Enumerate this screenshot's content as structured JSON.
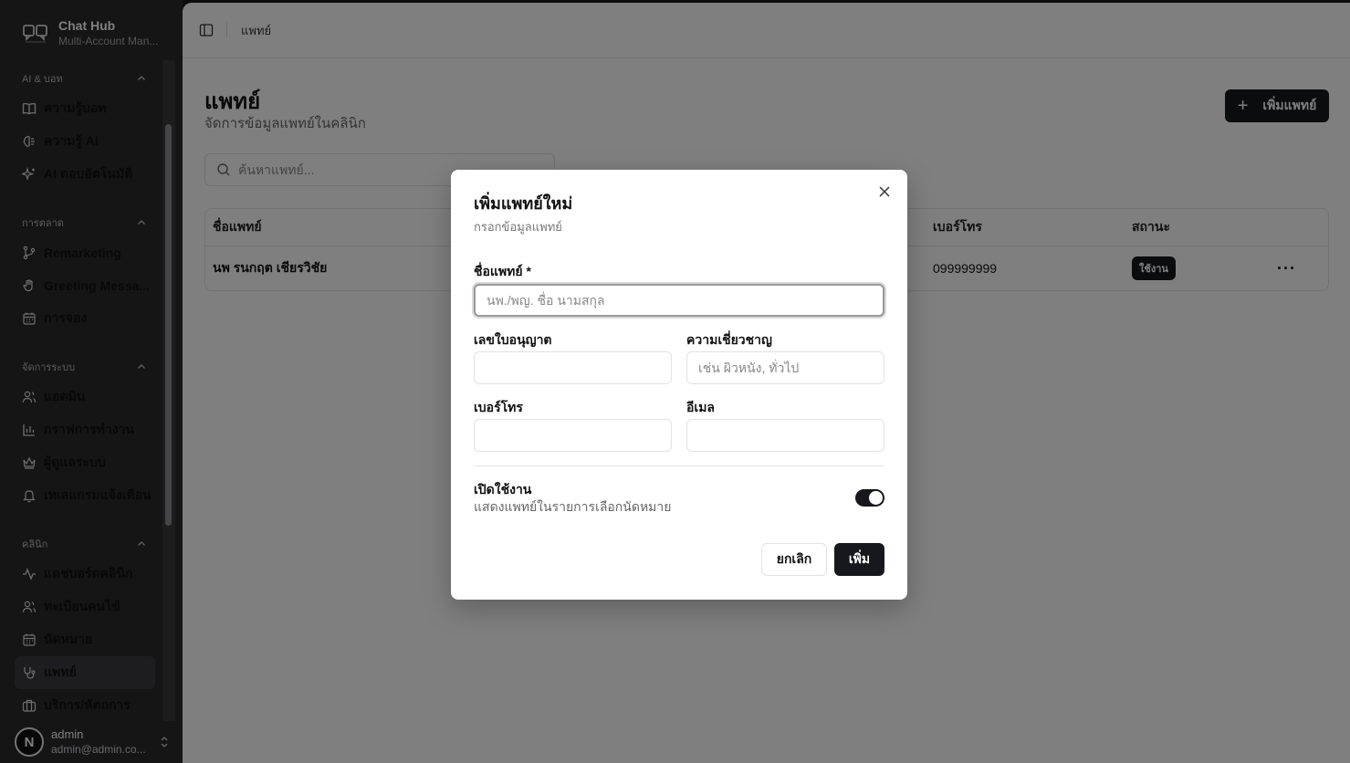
{
  "app": {
    "name": "Chat Hub",
    "subtitle": "Multi-Account Man..."
  },
  "sidebar": {
    "groups": [
      {
        "title": "AI & บอท",
        "items": [
          "ความรู้บอท",
          "ความรู้ AI",
          "AI ตอบอัตโนมัติ"
        ]
      },
      {
        "title": "การตลาด",
        "items": [
          "Remarketing",
          "Greeting Messa...",
          "การจอง"
        ]
      },
      {
        "title": "จัดการระบบ",
        "items": [
          "แอดมิน",
          "กราฟการทำงาน",
          "ผู้ดูแลระบบ",
          "เทเลแกรมแจ้งเตือน"
        ]
      },
      {
        "title": "คลินิก",
        "items": [
          "แดชบอร์ดคลินิก",
          "ทะเบียนคนไข้",
          "นัดหมาย",
          "แพทย์",
          "บริการ/หัตถการ"
        ]
      }
    ],
    "active_item": "แพทย์"
  },
  "user": {
    "avatar_letter": "N",
    "name": "admin",
    "email": "admin@admin.co..."
  },
  "topbar": {
    "breadcrumb": "แพทย์"
  },
  "page": {
    "title": "แพทย์",
    "subtitle": "จัดการข้อมูลแพทย์ในคลินิก",
    "add_button": "เพิ่มแพทย์",
    "search_placeholder": "ค้นหาแพทย์..."
  },
  "table": {
    "headers": {
      "name": "ชื่อแพทย์",
      "phone": "เบอร์โทร",
      "status": "สถานะ"
    },
    "rows": [
      {
        "name": "นพ รนกฤต เชียรวิชัย",
        "phone": "099999999",
        "status": "ใช้งาน"
      }
    ]
  },
  "dialog": {
    "title": "เพิ่มแพทย์ใหม่",
    "subtitle": "กรอกข้อมูลแพทย์",
    "name_label": "ชื่อแพทย์ *",
    "name_placeholder": "นพ./พญ. ชื่อ นามสกุล",
    "license_label": "เลขใบอนุญาต",
    "specialty_label": "ความเชี่ยวชาญ",
    "specialty_placeholder": "เช่น ผิวหนัง, ทั่วไป",
    "phone_label": "เบอร์โทร",
    "email_label": "อีเมล",
    "toggle_title": "เปิดใช้งาน",
    "toggle_desc": "แสดงแพทย์ในรายการเลือกนัดหมาย",
    "toggle_on": true,
    "cancel": "ยกเลิก",
    "submit": "เพิ่ม"
  },
  "colors": {
    "primary": "#16181d",
    "sidebar_bg": "#2b2b2d",
    "overlay": "rgba(0,0,0,0.5)"
  }
}
